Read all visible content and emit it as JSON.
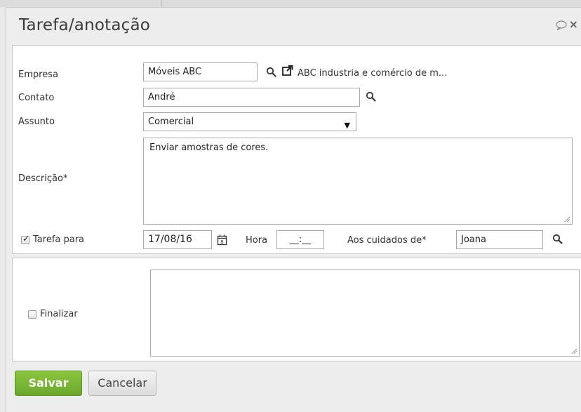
{
  "dialog": {
    "title": "Tarefa/anotação",
    "close_glyph": "×"
  },
  "form": {
    "empresa": {
      "label": "Empresa",
      "value": "Móveis ABC",
      "company_full_name": "ABC industria e comércio de m..."
    },
    "contato": {
      "label": "Contato",
      "value": "André"
    },
    "assunto": {
      "label": "Assunto",
      "selected": "Comercial"
    },
    "descricao": {
      "label": "Descrição*",
      "value": "Enviar amostras de cores."
    },
    "tarefa": {
      "checkbox_label": "Tarefa para",
      "checked": true,
      "date": "17/08/16",
      "hora_label": "Hora",
      "hora_value": "__:__",
      "aos_cuidados_label": "Aos cuidados de*",
      "aos_cuidados_value": "Joana"
    },
    "finalizar": {
      "checkbox_label": "Finalizar",
      "checked": false,
      "value": ""
    }
  },
  "buttons": {
    "save_label": "Salvar",
    "cancel_label": "Cancelar"
  },
  "colors": {
    "save_button": "#7ab535",
    "panel_bg": "#ffffff",
    "dialog_bg": "#ededed"
  },
  "icons": {
    "search": "search-icon",
    "external_link": "external-link-icon",
    "calendar": "calendar-icon",
    "chat": "chat-bubble-icon",
    "close": "close-icon"
  }
}
